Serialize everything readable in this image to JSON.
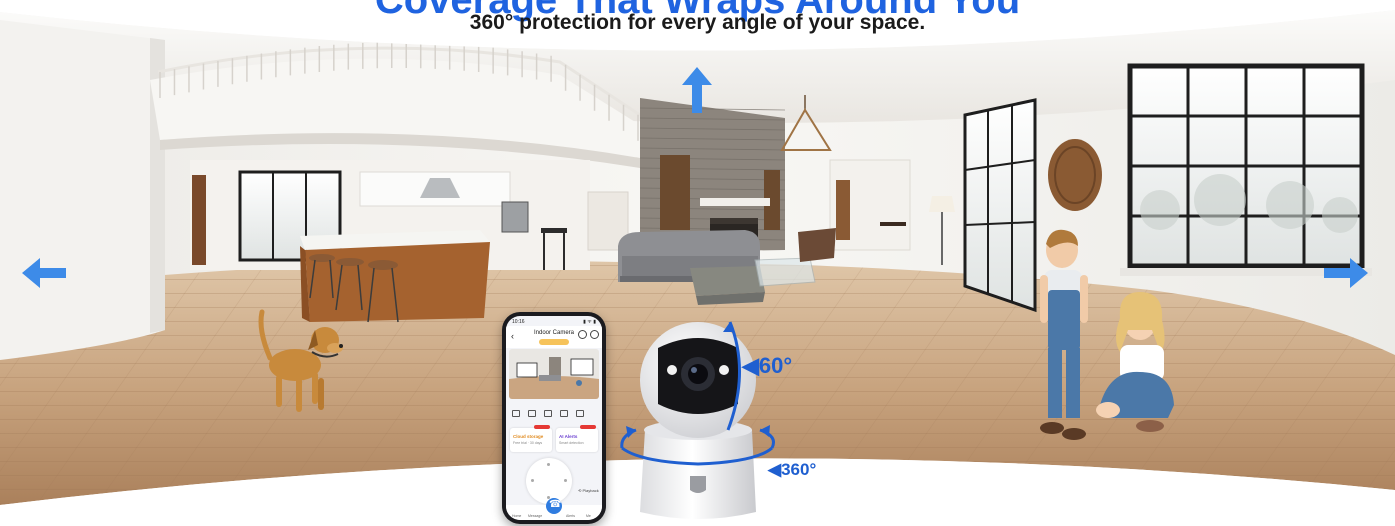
{
  "headline": {
    "title": "Coverage That Wraps Around You",
    "subtitle": "360° protection for every angle of your space.",
    "title_color": "#1f63e0"
  },
  "labels": {
    "tilt": "◀60°",
    "pan": "◀360°"
  },
  "arrows": [
    "arrow-up-icon",
    "arrow-left-icon",
    "arrow-right-icon"
  ],
  "phone_app": {
    "status_time": "10:16",
    "status_icons": "▮ ᯤ ▮",
    "screen_title": "Indoor Camera",
    "back_glyph": "‹",
    "cards": [
      {
        "title": "Cloud storage",
        "subtitle": "Free trial · 30 days",
        "color": "#e08a1e"
      },
      {
        "title": "AI Alerts",
        "subtitle": "Smart detection",
        "color": "#6a3fd0"
      }
    ],
    "playback": "⟲ Playback",
    "nav": [
      "Home",
      "Message",
      "Call",
      "Alerts",
      "Me"
    ]
  },
  "colors": {
    "accent": "#1f63e0",
    "arrow": "#3d8be8",
    "floor": "#c9a98a",
    "wall": "#f4f2ee",
    "kitchen_wood": "#a5622f",
    "stone": "#8c857d",
    "sofa": "#8e8f93",
    "window_frame": "#1e1e1e"
  }
}
